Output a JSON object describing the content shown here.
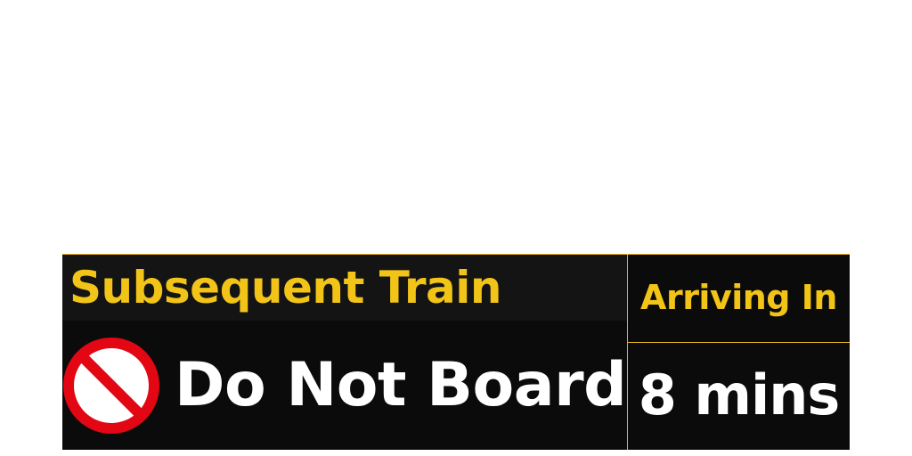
{
  "board": {
    "title": "Subsequent Train",
    "status_icon": "no-entry-icon",
    "status_text": "Do Not Board",
    "arriving_label": "Arriving In",
    "arriving_value": "8 mins"
  },
  "colors": {
    "accent": "#f2c418",
    "panel": "#0b0b0b",
    "title_strip": "#141414",
    "icon_red": "#e30613",
    "text_white": "#ffffff"
  }
}
